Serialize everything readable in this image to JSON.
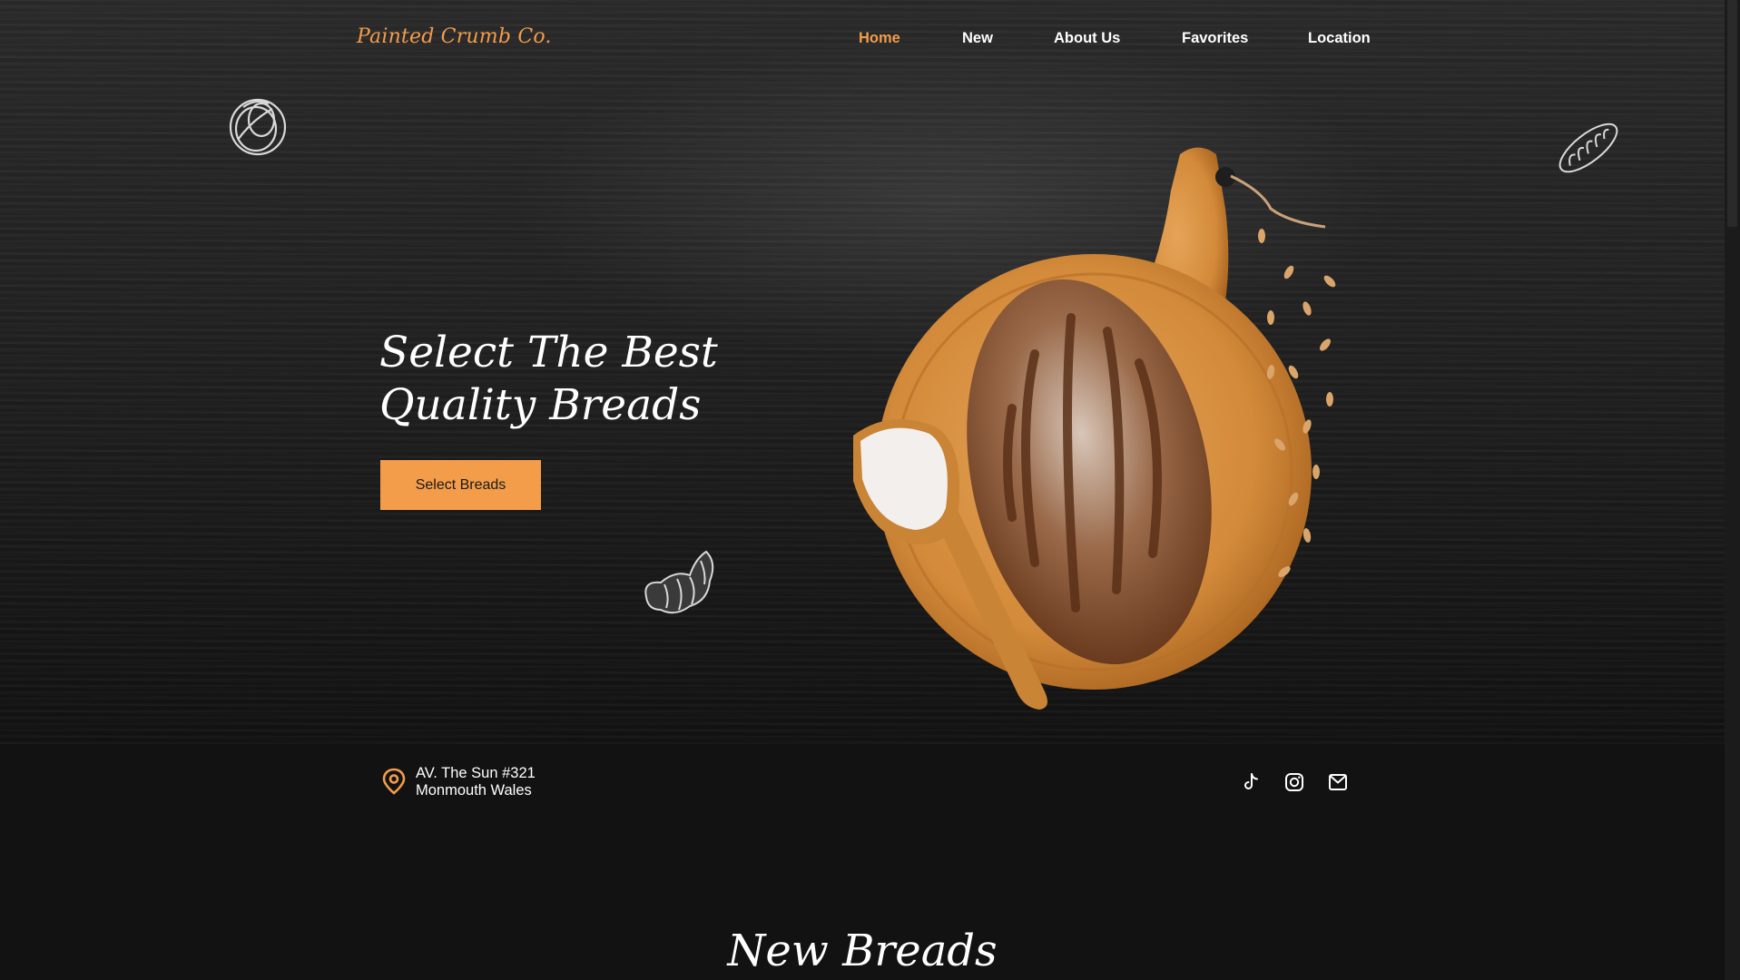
{
  "brand": {
    "name": "Painted Crumb Co.",
    "accent_color": "#f39c4a"
  },
  "nav": {
    "items": [
      {
        "label": "Home",
        "active": true
      },
      {
        "label": "New",
        "active": false
      },
      {
        "label": "About Us",
        "active": false
      },
      {
        "label": "Favorites",
        "active": false
      },
      {
        "label": "Location",
        "active": false
      }
    ]
  },
  "hero": {
    "title_line1": "Select The Best",
    "title_line2": "Quality Breads",
    "cta_label": "Select Breads",
    "image": "bread-loaf-on-wooden-board-with-flour-scoop"
  },
  "decorations": [
    "pretzel-doodle",
    "baguette-doodle",
    "croissant-doodle"
  ],
  "contact": {
    "icon": "location-pin-icon",
    "address_line1": "AV. The Sun #321",
    "address_line2": "Monmouth Wales"
  },
  "social": [
    "tiktok-icon",
    "instagram-icon",
    "mail-icon"
  ],
  "sections": {
    "new_breads_title": "New Breads"
  }
}
